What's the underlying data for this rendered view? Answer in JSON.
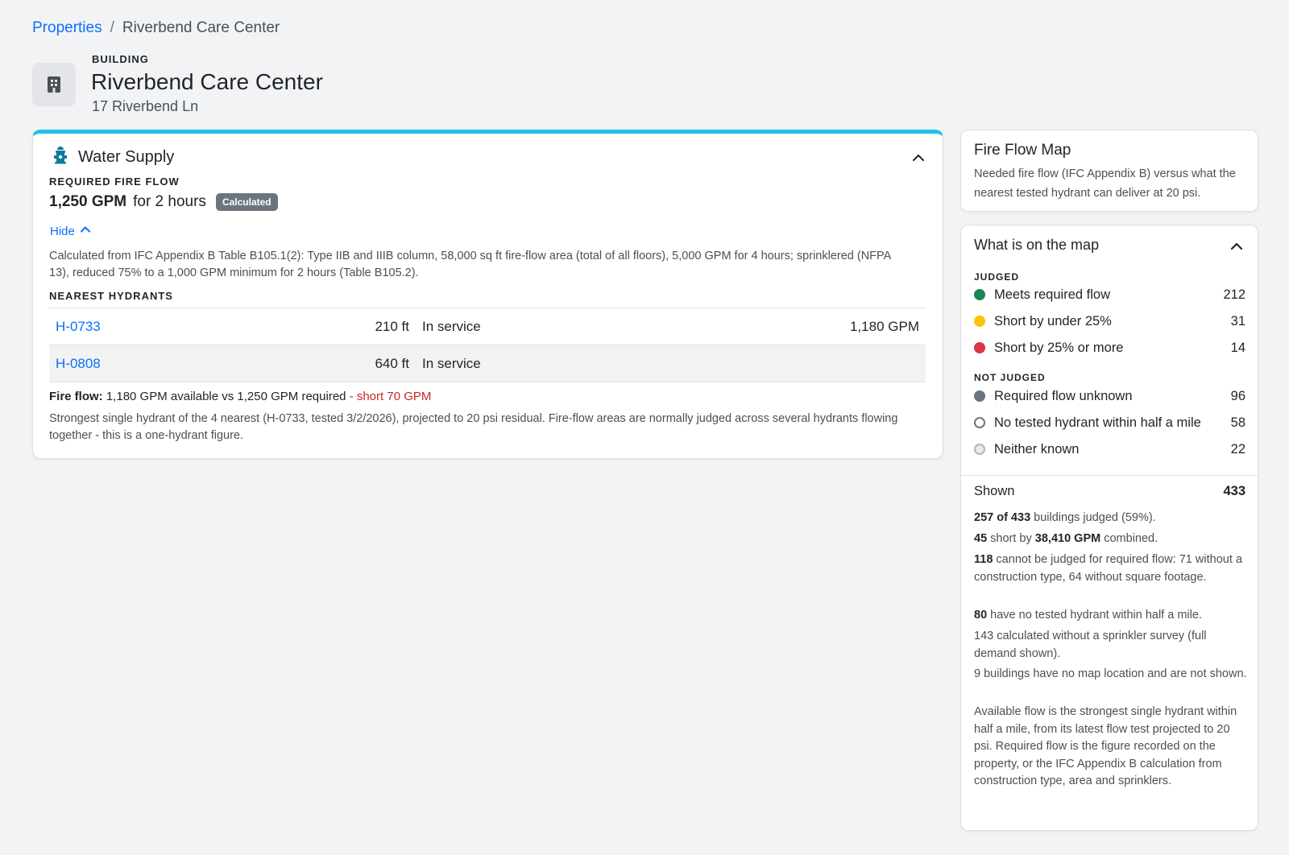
{
  "breadcrumb": {
    "root": "Properties",
    "separator": "/",
    "current": "Riverbend Care Center"
  },
  "building": {
    "kicker": "BUILDING",
    "name": "Riverbend Care Center",
    "address": "17 Riverbend Ln",
    "icon": "building-icon"
  },
  "water_supply": {
    "title": "Water Supply",
    "icon": "hydrant-icon",
    "accent_color": "#22c1e6",
    "required_label": "REQUIRED FIRE FLOW",
    "required_value": "1,250 GPM",
    "required_duration": "for 2 hours",
    "badge": "Calculated",
    "hide_label": "Hide",
    "calculation": "Calculated from IFC Appendix B Table B105.1(2): Type IIB and IIIB column, 58,000 sq ft fire-flow area (total of all floors), 5,000 GPM for 4 hours; sprinklered (NFPA 13), reduced 75% to a 1,000 GPM minimum for 2 hours (Table B105.2).",
    "nearest_label": "NEAREST HYDRANTS",
    "hydrants": [
      {
        "id": "H-0733",
        "distance": "210 ft",
        "status": "In service",
        "flow": "1,180 GPM"
      },
      {
        "id": "H-0808",
        "distance": "640 ft",
        "status": "In service",
        "flow": ""
      }
    ],
    "fire_flow_label": "Fire flow:",
    "fire_flow_text": "1,180 GPM available vs 1,250 GPM required",
    "fire_flow_short": "- short 70 GPM",
    "note": "Strongest single hydrant of the 4 nearest (H-0733, tested 3/2/2026), projected to 20 psi residual. Fire-flow areas are normally judged across several hydrants flowing together - this is a one-hydrant figure."
  },
  "fire_flow_map": {
    "title": "Fire Flow Map",
    "description": "Needed fire flow (IFC Appendix B) versus what the nearest tested hydrant can deliver at 20 psi."
  },
  "map_legend": {
    "title": "What is on the map",
    "judged_label": "JUDGED",
    "judged": [
      {
        "label": "Meets required flow",
        "count": "212",
        "color": "#198754",
        "style": "filled"
      },
      {
        "label": "Short by under 25%",
        "count": "31",
        "color": "#ffc107",
        "style": "filled"
      },
      {
        "label": "Short by 25% or more",
        "count": "14",
        "color": "#dc3545",
        "style": "filled"
      }
    ],
    "not_judged_label": "NOT JUDGED",
    "not_judged": [
      {
        "label": "Required flow unknown",
        "count": "96",
        "color": "#6c757d",
        "style": "filled"
      },
      {
        "label": "No tested hydrant within half a mile",
        "count": "58",
        "color": "#6c757d",
        "style": "ring"
      },
      {
        "label": "Neither known",
        "count": "22",
        "color": "#adb5bd",
        "style": "ring-light"
      }
    ],
    "shown_label": "Shown",
    "shown_count": "433",
    "stats": {
      "judged_bold": "257 of 433",
      "judged_text": " buildings judged (59%).",
      "short_count": "45",
      "short_mid": " short by ",
      "short_gpm": "38,410 GPM",
      "short_end": " combined.",
      "cannot_bold": "118",
      "cannot_text": " cannot be judged for required flow: 71 without a construction type, 64 without square footage.",
      "no_hyd_bold": "80",
      "no_hyd_text": " have no tested hydrant within half a mile.",
      "sprinkler": "143 calculated without a sprinkler survey (full demand shown).",
      "no_location": "9 buildings have no map location and are not shown.",
      "method": "Available flow is the strongest single hydrant within half a mile, from its latest flow test projected to 20 psi. Required flow is the figure recorded on the property, or the IFC Appendix B calculation from construction type, area and sprinklers."
    }
  }
}
